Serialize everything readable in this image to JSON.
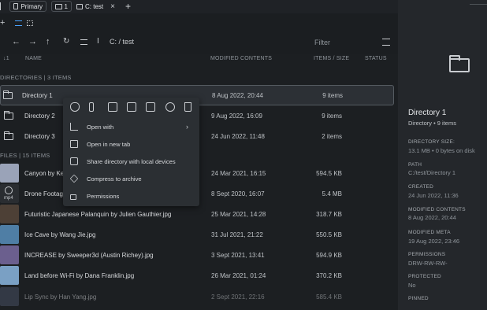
{
  "tabs": {
    "primary_label": "Primary",
    "count_label": "1",
    "active_tab_label": "C: test",
    "close_symbol": "×",
    "new_tab_symbol": "+"
  },
  "toolbar": {
    "path_label": "C: / test",
    "filter_placeholder": "Filter"
  },
  "columns": {
    "name": "NAME",
    "modified": "MODIFIED CONTENTS",
    "items_size": "ITEMS / SIZE",
    "status": "STATUS"
  },
  "sections": {
    "directories": "DIRECTORIES | 3 ITEMS",
    "files": "FILES | 15 ITEMS"
  },
  "directories": [
    {
      "name": "Directory 1",
      "modified": "8 Aug 2022, 20:44",
      "items": "9 items"
    },
    {
      "name": "Directory 2",
      "modified": "9 Aug 2022, 16:09",
      "items": "9 items"
    },
    {
      "name": "Directory 3",
      "modified": "24 Jun 2022, 11:48",
      "items": "2 items"
    }
  ],
  "files": [
    {
      "name": "Canyon by Kev",
      "modified": "24 Mar 2021, 16:15",
      "size": "594.5 KB",
      "thumb": "#9aa3b8"
    },
    {
      "name": "Drone Footage",
      "modified": "8 Sept 2020, 16:07",
      "size": "5.4 MB",
      "thumb": "#3a3e44",
      "badge": "mp4"
    },
    {
      "name": "Futuristic Japanese Palanquin by Julien Gauthier.jpg",
      "modified": "25 Mar 2021, 14:28",
      "size": "318.7 KB",
      "thumb": "#4d4036"
    },
    {
      "name": "Ice Cave by Wang Jie.jpg",
      "modified": "31 Jul 2021, 21:22",
      "size": "550.5 KB",
      "thumb": "#4f7ea5"
    },
    {
      "name": "INCREASE by Sweeper3d (Austin Richey).jpg",
      "modified": "3 Sept 2021, 13:41",
      "size": "594.9 KB",
      "thumb": "#6b5f8e"
    },
    {
      "name": "Land before Wi-Fi by Dana Franklin.jpg",
      "modified": "26 Mar 2021, 01:24",
      "size": "370.2 KB",
      "thumb": "#7aa0c4"
    },
    {
      "name": "Lip Sync by Han Yang.jpg",
      "modified": "2 Sept 2021, 22:16",
      "size": "585.4 KB",
      "thumb": "#4a5368"
    }
  ],
  "context_menu": {
    "open_with": "Open with",
    "open_new_tab": "Open in new tab",
    "share": "Share directory with local devices",
    "compress": "Compress to archive",
    "permissions": "Permissions"
  },
  "details": {
    "title": "Directory 1",
    "subtitle": "Directory • 9 items",
    "size_label": "DIRECTORY SIZE:",
    "size_value": "13.1 MB • 0 bytes on disk",
    "path_label": "PATH",
    "path_value": "C:/test/Directory 1",
    "created_label": "CREATED",
    "created_value": "24 Jun 2022, 11:36",
    "modified_label": "MODIFIED CONTENTS",
    "modified_value": "8 Aug 2022, 20:44",
    "modmeta_label": "MODIFIED META",
    "modmeta_value": "19 Aug 2022, 23:46",
    "perm_label": "PERMISSIONS",
    "perm_value": "DRW-RW-RW-",
    "protected_label": "PROTECTED",
    "protected_value": "No",
    "pinned_label": "PINNED"
  },
  "colors": {
    "background": "#1b1e21",
    "panel": "#24272b",
    "menu": "#2b2f33",
    "selected_row": "#2c3035"
  }
}
